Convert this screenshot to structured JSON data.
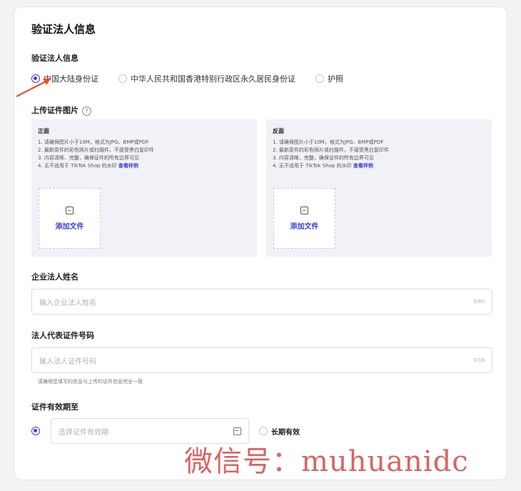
{
  "section_title": "验证法人信息",
  "id_type": {
    "label": "验证法人信息",
    "options": [
      "中国大陆身份证",
      "中华人民共和国香港特别行政区永久居民身份证",
      "护照"
    ],
    "selected": 0
  },
  "upload": {
    "label": "上传证件图片",
    "help_icon": "?",
    "front": {
      "title": "正面",
      "requirements": [
        "1. 请确保图片小于10M，格式为JPG、BMP或PDF",
        "2. 最新原件的彩色照片或扫描件，不接受黑白复印件",
        "3. 内容清晰、完整，确保证件的所有边界可见"
      ],
      "req4_prefix": "4. 无不适用于 TikTok Shop 的水印 ",
      "sample_link": "查看样例",
      "add_file": "添加文件"
    },
    "back": {
      "title": "反面",
      "requirements": [
        "1. 请确保图片小于10M，格式为JPG、BMP或PDF",
        "2. 最新原件的彩色照片或扫描件，不接受黑白复印件",
        "3. 内容清晰、完整，确保证件的所有边界可见"
      ],
      "req4_prefix": "4. 无不适用于 TikTok Shop 的水印 ",
      "sample_link": "查看样例",
      "add_file": "添加文件"
    }
  },
  "legal_name": {
    "label": "企业法人姓名",
    "placeholder": "输入企业法人姓名",
    "count": "0/80"
  },
  "id_number": {
    "label": "法人代表证件号码",
    "placeholder": "输入法人证件号码",
    "count": "0/18",
    "hint": "请确保您填写的信息与上传的证件信息完全一致"
  },
  "validity": {
    "label": "证件有效期至",
    "placeholder": "选择证件有效期",
    "long_term": "长期有效"
  },
  "watermark": "微信号：muhuanidc",
  "colors": {
    "accent": "#3a3fd6",
    "arrow": "#e8542a",
    "watermark": "#d44a4a"
  }
}
